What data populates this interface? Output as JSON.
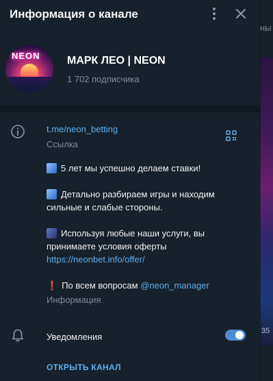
{
  "header": {
    "title": "Информация о канале",
    "more_icon": "more-vertical-icon",
    "close_icon": "close-icon"
  },
  "background": {
    "peek_text": "ны",
    "peek_time": "35"
  },
  "channel": {
    "avatar_text": "NEON",
    "name": "МАРК ЛЕО | NEON",
    "subscribers": "1 702 подписчика"
  },
  "link_section": {
    "icon": "info-icon",
    "link": "t.me/neon_betting",
    "caption": "Ссылка",
    "qr_icon": "qr-code-icon"
  },
  "description": {
    "line1": "5 лет мы успешно делаем ставки!",
    "line2": "Детально разбираем игры и находим сильные и слабые стороны.",
    "line3": "Используя любые наши услуги, вы принимаете условия оферты",
    "offer_link": "https://neonbet.info/offer/",
    "bang": "❗",
    "line4_prefix": "По всем вопросам ",
    "mention": "@neon_manager",
    "caption": "Информация"
  },
  "notifications": {
    "icon": "bell-icon",
    "label": "Уведомления",
    "enabled": true
  },
  "actions": {
    "open_channel": "ОТКРЫТЬ КАНАЛ"
  },
  "colors": {
    "panel_bg": "#17212b",
    "accent": "#5cb0f0",
    "toggle_on": "#4a8ed1",
    "muted_text": "#7f8b97"
  }
}
